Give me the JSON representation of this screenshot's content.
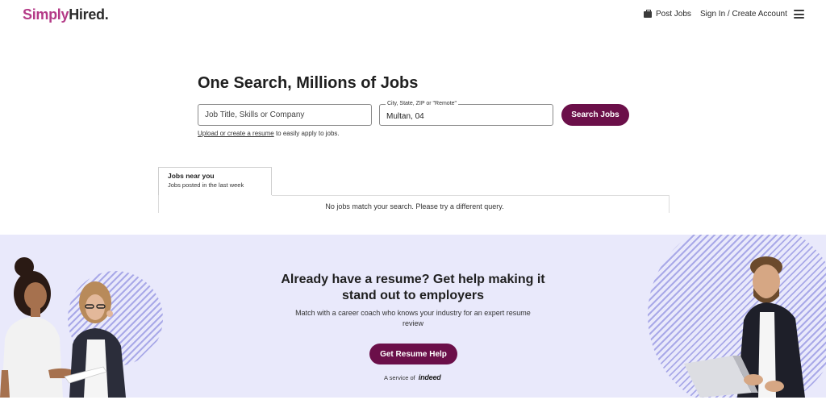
{
  "header": {
    "logo_simply": "Simply",
    "logo_hired": "Hired.",
    "post_jobs": "Post Jobs",
    "sign_in": "Sign In / Create Account"
  },
  "search": {
    "headline": "One Search, Millions of Jobs",
    "what_placeholder": "Job Title, Skills or Company",
    "where_label": "City, State, ZIP or \"Remote\"",
    "where_value": "Multan, 04",
    "button": "Search Jobs",
    "upload_link": "Upload or create a resume",
    "upload_rest": " to easily apply to jobs."
  },
  "results": {
    "tab_title": "Jobs near you",
    "tab_sub": "Jobs posted in the last week",
    "empty_message": "No jobs match your search. Please try a different query."
  },
  "promo": {
    "title": "Already have a resume? Get help making it stand out to employers",
    "subtitle": "Match with a career coach who knows your industry for an expert resume review",
    "button": "Get Resume Help",
    "service_prefix": "A service of",
    "service_brand": "indeed"
  },
  "colors": {
    "brand_pink": "#b43a87",
    "button_plum": "#6b0f49",
    "promo_bg": "#e9e9fb"
  },
  "icons": [
    "briefcase-icon",
    "menu-icon"
  ]
}
